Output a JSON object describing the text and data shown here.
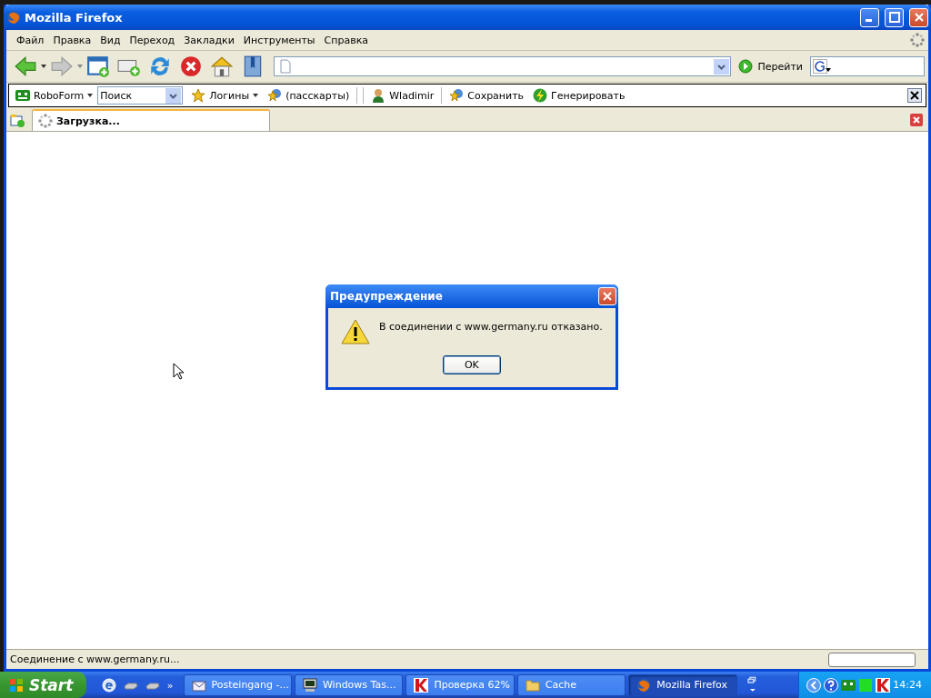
{
  "window": {
    "title": "Mozilla Firefox"
  },
  "menu": [
    {
      "label": "Файл"
    },
    {
      "label": "Правка"
    },
    {
      "label": "Вид"
    },
    {
      "label": "Переход"
    },
    {
      "label": "Закладки"
    },
    {
      "label": "Инструменты"
    },
    {
      "label": "Справка"
    }
  ],
  "nav_toolbar": {
    "go_button": "Перейти"
  },
  "roboform_toolbar": {
    "brand": "RoboForm",
    "search": {
      "value": "Поиск"
    },
    "buttons": [
      {
        "label": "Логины",
        "kind": "star",
        "dropdown": true
      },
      {
        "label": "(пасскарты)",
        "kind": "star-globe",
        "dropdown": false
      },
      {
        "label": "Wladimir",
        "kind": "person",
        "dropdown": false
      },
      {
        "label": "Сохранить",
        "kind": "star-globe",
        "dropdown": false
      },
      {
        "label": "Генерировать",
        "kind": "bolt",
        "dropdown": false
      }
    ]
  },
  "tabs": [
    {
      "label": "Загрузка...",
      "selected": true
    }
  ],
  "dialog": {
    "title": "Предупреждение",
    "message": "В соединении с www.germany.ru отказано.",
    "buttons": [
      "OK"
    ]
  },
  "status_bar": {
    "text": "Соединение с www.germany.ru..."
  },
  "taskbar": {
    "start": "Start",
    "quick_launch_more": "»",
    "tasks": [
      {
        "label": "Posteingang -...",
        "kind": "mail",
        "selected": false
      },
      {
        "label": "Windows Tas...",
        "kind": "monitor",
        "selected": false
      },
      {
        "label": "Проверка 62%",
        "kind": "antivirus",
        "selected": false
      },
      {
        "label": "Cache",
        "kind": "folder",
        "selected": false
      },
      {
        "label": "Mozilla Firefox",
        "kind": "firefox",
        "selected": true
      }
    ],
    "clock": "14:24"
  }
}
